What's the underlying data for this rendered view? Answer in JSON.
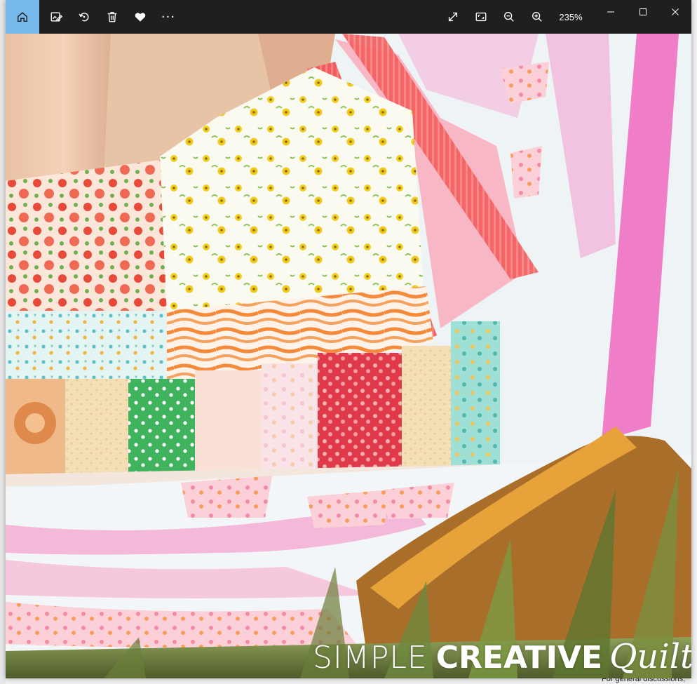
{
  "toolbar": {
    "home_icon": "home-icon",
    "edit_icon": "edit-image-icon",
    "rotate_icon": "rotate-icon",
    "delete_icon": "trash-icon",
    "favorite_icon": "heart-icon",
    "more_label": "···",
    "fullscreen_icon": "expand-icon",
    "fit_icon": "fit-window-icon",
    "zoom_out_icon": "zoom-out-icon",
    "zoom_in_icon": "zoom-in-icon",
    "zoom_level": "235%"
  },
  "window_controls": {
    "minimize": "minimize-icon",
    "maximize": "maximize-icon",
    "close": "close-icon"
  },
  "photo": {
    "watermark": {
      "simple": "SIMPLE",
      "creative": "CREATIVE",
      "quilts": "Quilts"
    }
  },
  "background": {
    "bottom_text": "For general discussions,"
  },
  "colors": {
    "titlebar": "#1f1f1f",
    "home_active": "#76b9ed"
  }
}
